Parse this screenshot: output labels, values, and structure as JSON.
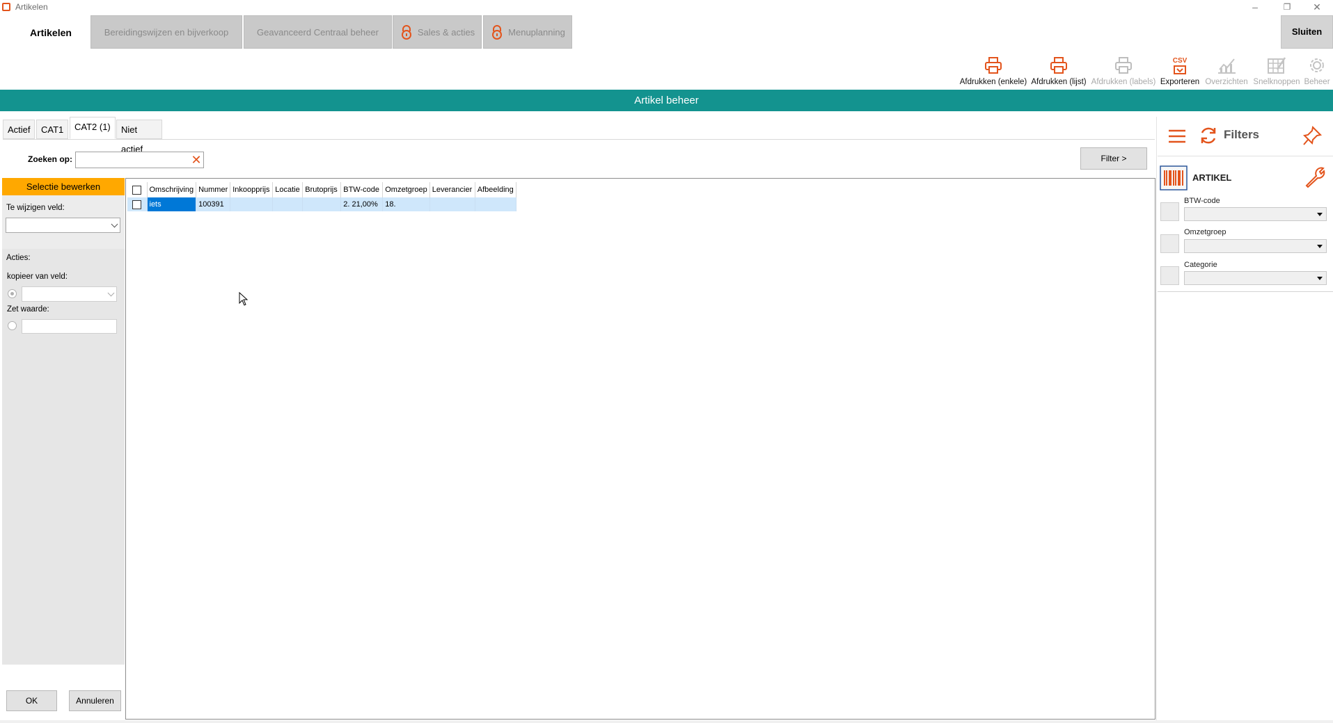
{
  "window": {
    "title": "Artikelen",
    "minimize": "–",
    "restore": "❐",
    "close": "✕"
  },
  "modules": {
    "active": "Artikelen",
    "tabs": [
      "Bereidingswijzen en bijverkoop",
      "Geavanceerd Centraal beheer",
      "Sales & acties",
      "Menuplanning"
    ],
    "close_label": "Sluiten"
  },
  "toolbar": {
    "items": [
      {
        "label": "Afdrukken (enkele)",
        "icon": "printer-icon",
        "enabled": true
      },
      {
        "label": "Afdrukken (lijst)",
        "icon": "printer-icon",
        "enabled": true
      },
      {
        "label": "Afdrukken (labels)",
        "icon": "printer-icon",
        "enabled": false
      },
      {
        "label": "Exporteren",
        "icon": "csv-icon",
        "enabled": true
      },
      {
        "label": "Overzichten",
        "icon": "chart-icon",
        "enabled": false
      },
      {
        "label": "Snelknoppen",
        "icon": "quick-buttons-icon",
        "enabled": false
      },
      {
        "label": "Beheer",
        "icon": "gear-icon",
        "enabled": false
      }
    ],
    "csv_text": "CSV"
  },
  "header": {
    "title": "Artikel beheer"
  },
  "tabs": [
    "Actief",
    "CAT1",
    "CAT2 (1)",
    "Niet actief"
  ],
  "search": {
    "label": "Zoeken op:",
    "value": "",
    "filter_button": "Filter >"
  },
  "selection_panel": {
    "title": "Selectie bewerken",
    "field_label": "Te wijzigen veld:",
    "field_value": "",
    "actions_label": "Acties:",
    "copy_label": "kopieer van veld:",
    "set_label": "Zet waarde:",
    "set_value": "",
    "ok": "OK",
    "cancel": "Annuleren"
  },
  "grid": {
    "columns": [
      "Omschrijving",
      "Nummer",
      "Inkoopprijs",
      "Locatie",
      "Brutoprijs",
      "BTW-code",
      "Omzetgroep",
      "Leverancier",
      "Afbeelding"
    ],
    "rows": [
      [
        "iets",
        "100391",
        "",
        "",
        "",
        "2. 21,00%",
        "18.",
        "",
        ""
      ]
    ]
  },
  "filters": {
    "title": "Filters",
    "section": "ARTIKEL",
    "fields": [
      {
        "label": "BTW-code",
        "value": ""
      },
      {
        "label": "Omzetgroep",
        "value": ""
      },
      {
        "label": "Categorie",
        "value": ""
      }
    ]
  },
  "colors": {
    "accent": "#e3541c",
    "header": "#13938f",
    "selection": "#ffa800",
    "row_selected": "#0078d7"
  }
}
